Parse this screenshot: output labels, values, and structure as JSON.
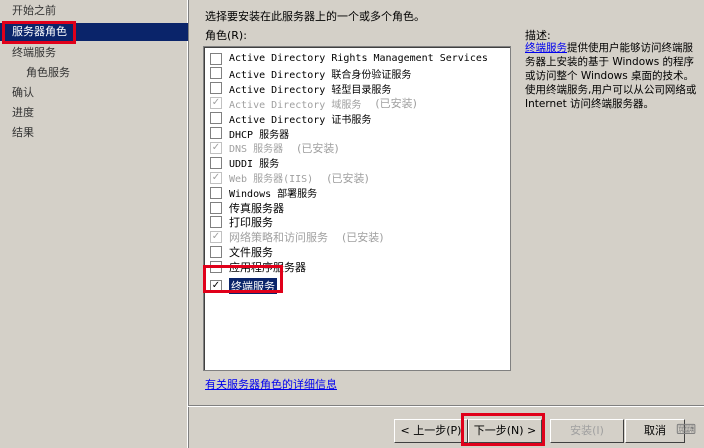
{
  "sidebar": {
    "items": [
      {
        "label": "开始之前"
      },
      {
        "label": "服务器角色"
      },
      {
        "label": "终端服务"
      },
      {
        "label": "角色服务"
      },
      {
        "label": "确认"
      },
      {
        "label": "进度"
      },
      {
        "label": "结果"
      }
    ]
  },
  "main": {
    "prompt": "选择要安装在此服务器上的一个或多个角色。",
    "roles_label": "角色(R):",
    "roles": [
      {
        "label": "Active Directory Rights Management Services",
        "checked": false,
        "installed": ""
      },
      {
        "label": "Active Directory 联合身份验证服务",
        "checked": false,
        "installed": ""
      },
      {
        "label": "Active Directory 轻型目录服务",
        "checked": false,
        "installed": ""
      },
      {
        "label": "Active Directory 域服务",
        "checked": true,
        "installed": "(已安装)"
      },
      {
        "label": "Active Directory 证书服务",
        "checked": false,
        "installed": ""
      },
      {
        "label": "DHCP 服务器",
        "checked": false,
        "installed": ""
      },
      {
        "label": "DNS 服务器",
        "checked": true,
        "installed": "(已安装)"
      },
      {
        "label": "UDDI 服务",
        "checked": false,
        "installed": ""
      },
      {
        "label": "Web 服务器(IIS)",
        "checked": true,
        "installed": "(已安装)"
      },
      {
        "label": "Windows 部署服务",
        "checked": false,
        "installed": ""
      },
      {
        "label": "传真服务器",
        "checked": false,
        "installed": ""
      },
      {
        "label": "打印服务",
        "checked": false,
        "installed": ""
      },
      {
        "label": "网络策略和访问服务",
        "checked": true,
        "installed": "(已安装)"
      },
      {
        "label": "文件服务",
        "checked": false,
        "installed": ""
      },
      {
        "label": "应用程序服务器",
        "checked": false,
        "installed": ""
      },
      {
        "label": "终端服务",
        "checked": true,
        "installed": ""
      }
    ],
    "more_link": "有关服务器角色的详细信息"
  },
  "description": {
    "title": "描述:",
    "link": "终端服务",
    "text": "提供使用户能够访问终端服务器上安装的基于 Windows 的程序或访问整个 Windows 桌面的技术。使用终端服务,用户可以从公司网络或 Internet 访问终端服务器。"
  },
  "buttons": {
    "back": "< 上一步(P)",
    "next": "下一步(N) >",
    "install": "安装(I)",
    "cancel": "取消"
  }
}
